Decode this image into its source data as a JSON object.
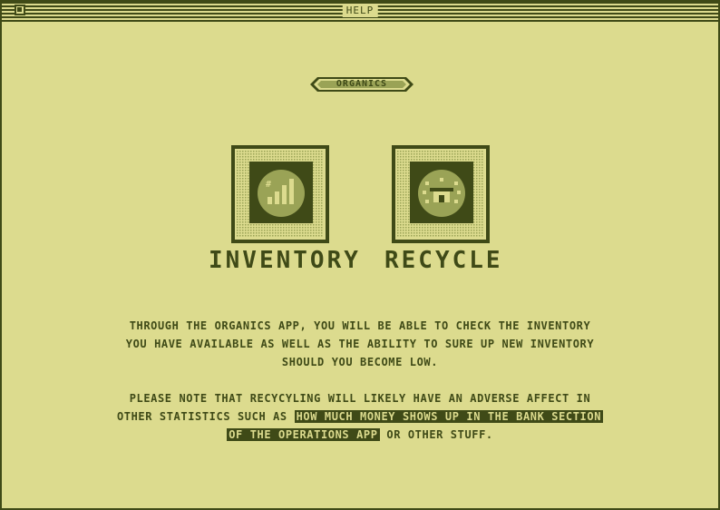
{
  "window": {
    "title": "HELP"
  },
  "section": {
    "label": "ORGANICS"
  },
  "apps": [
    {
      "label": "INVENTORY",
      "icon": "bar-chart-icon"
    },
    {
      "label": "RECYCLE",
      "icon": "recycle-icon"
    }
  ],
  "body": {
    "para1_lines": [
      "THROUGH THE ORGANICS APP, YOU WILL BE ABLE TO CHECK THE INVENTORY",
      "YOU HAVE AVAILABLE AS WELL AS THE ABILITY TO SURE UP NEW INVENTORY",
      "SHOULD YOU BECOME LOW."
    ],
    "para2": {
      "line1": "PLEASE NOTE THAT RECYCYLING WILL LIKELY HAVE AN ADVERSE AFFECT IN",
      "line2_prefix": "OTHER STATISTICS SUCH AS ",
      "highlight_line2": "HOW MUCH MONEY SHOWS UP IN THE BANK SECTION",
      "highlight_line3": "OF THE OPERATIONS APP",
      "line3_suffix": " OR OTHER STUFF."
    }
  },
  "colors": {
    "dark": "#3f4a17",
    "light": "#dcdb8e",
    "mid": "#9aa356"
  }
}
